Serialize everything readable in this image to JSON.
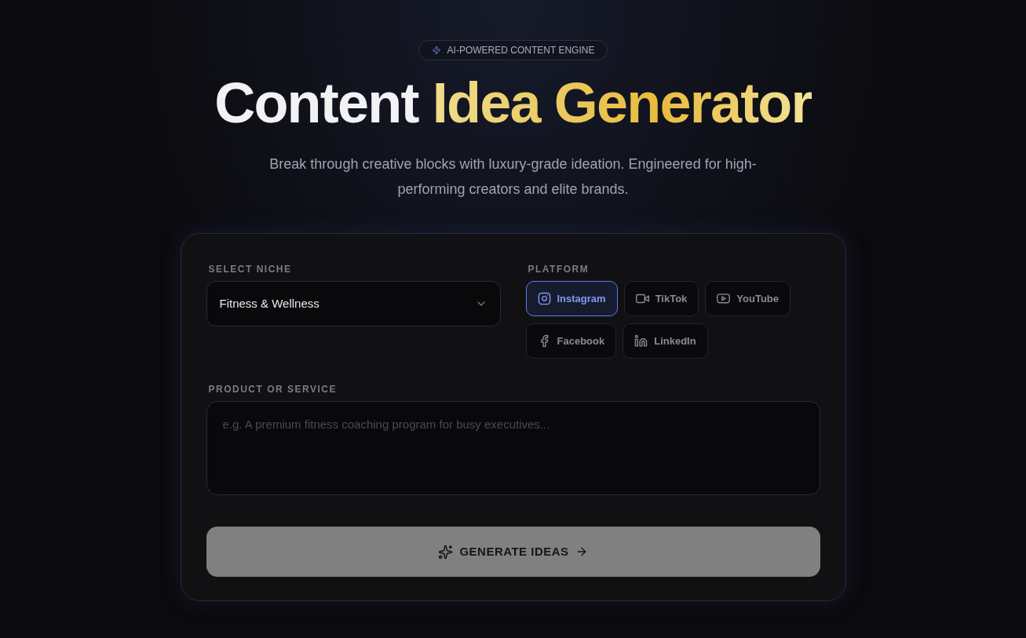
{
  "badge": "AI-POWERED CONTENT ENGINE",
  "title": {
    "lead": "Content",
    "highlight": "Idea Generator"
  },
  "subtitle": "Break through creative blocks with luxury-grade ideation. Engineered for high-performing creators and elite brands.",
  "niche": {
    "label": "SELECT NICHE",
    "value": "Fitness & Wellness"
  },
  "platform": {
    "label": "PLATFORM",
    "options": [
      {
        "kind": "instagram",
        "label": "Instagram",
        "selected": true
      },
      {
        "kind": "tiktok",
        "label": "TikTok",
        "selected": false
      },
      {
        "kind": "youtube",
        "label": "YouTube",
        "selected": false
      },
      {
        "kind": "facebook",
        "label": "Facebook",
        "selected": false
      },
      {
        "kind": "linkedin",
        "label": "LinkedIn",
        "selected": false
      }
    ]
  },
  "product": {
    "label": "PRODUCT OR SERVICE",
    "placeholder": "e.g. A premium fitness coaching program for busy executives..."
  },
  "generate": {
    "label": "GENERATE IDEAS",
    "disabled": true
  }
}
